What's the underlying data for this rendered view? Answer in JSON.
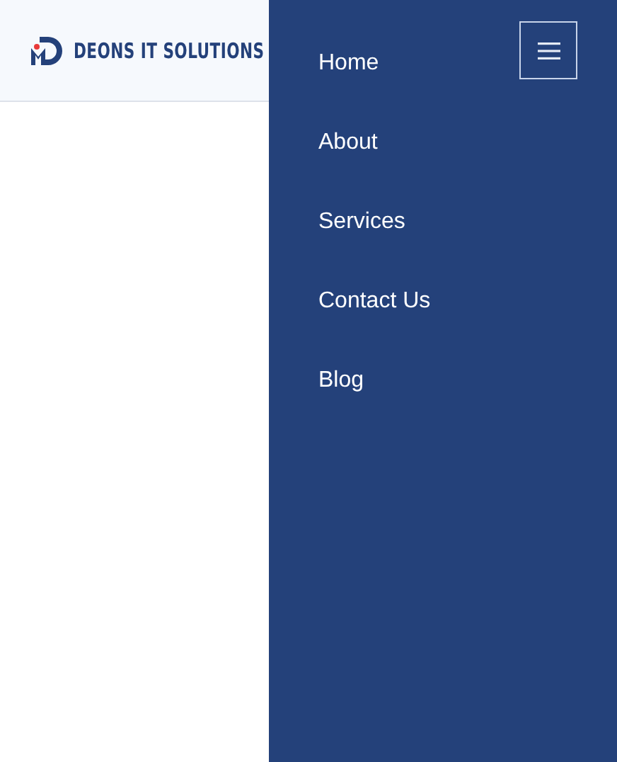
{
  "header": {
    "brand": "DEONS IT SOLUTIONS"
  },
  "menu": {
    "items": [
      {
        "label": "Home"
      },
      {
        "label": "About"
      },
      {
        "label": "Services"
      },
      {
        "label": "Contact Us"
      },
      {
        "label": "Blog"
      }
    ]
  }
}
